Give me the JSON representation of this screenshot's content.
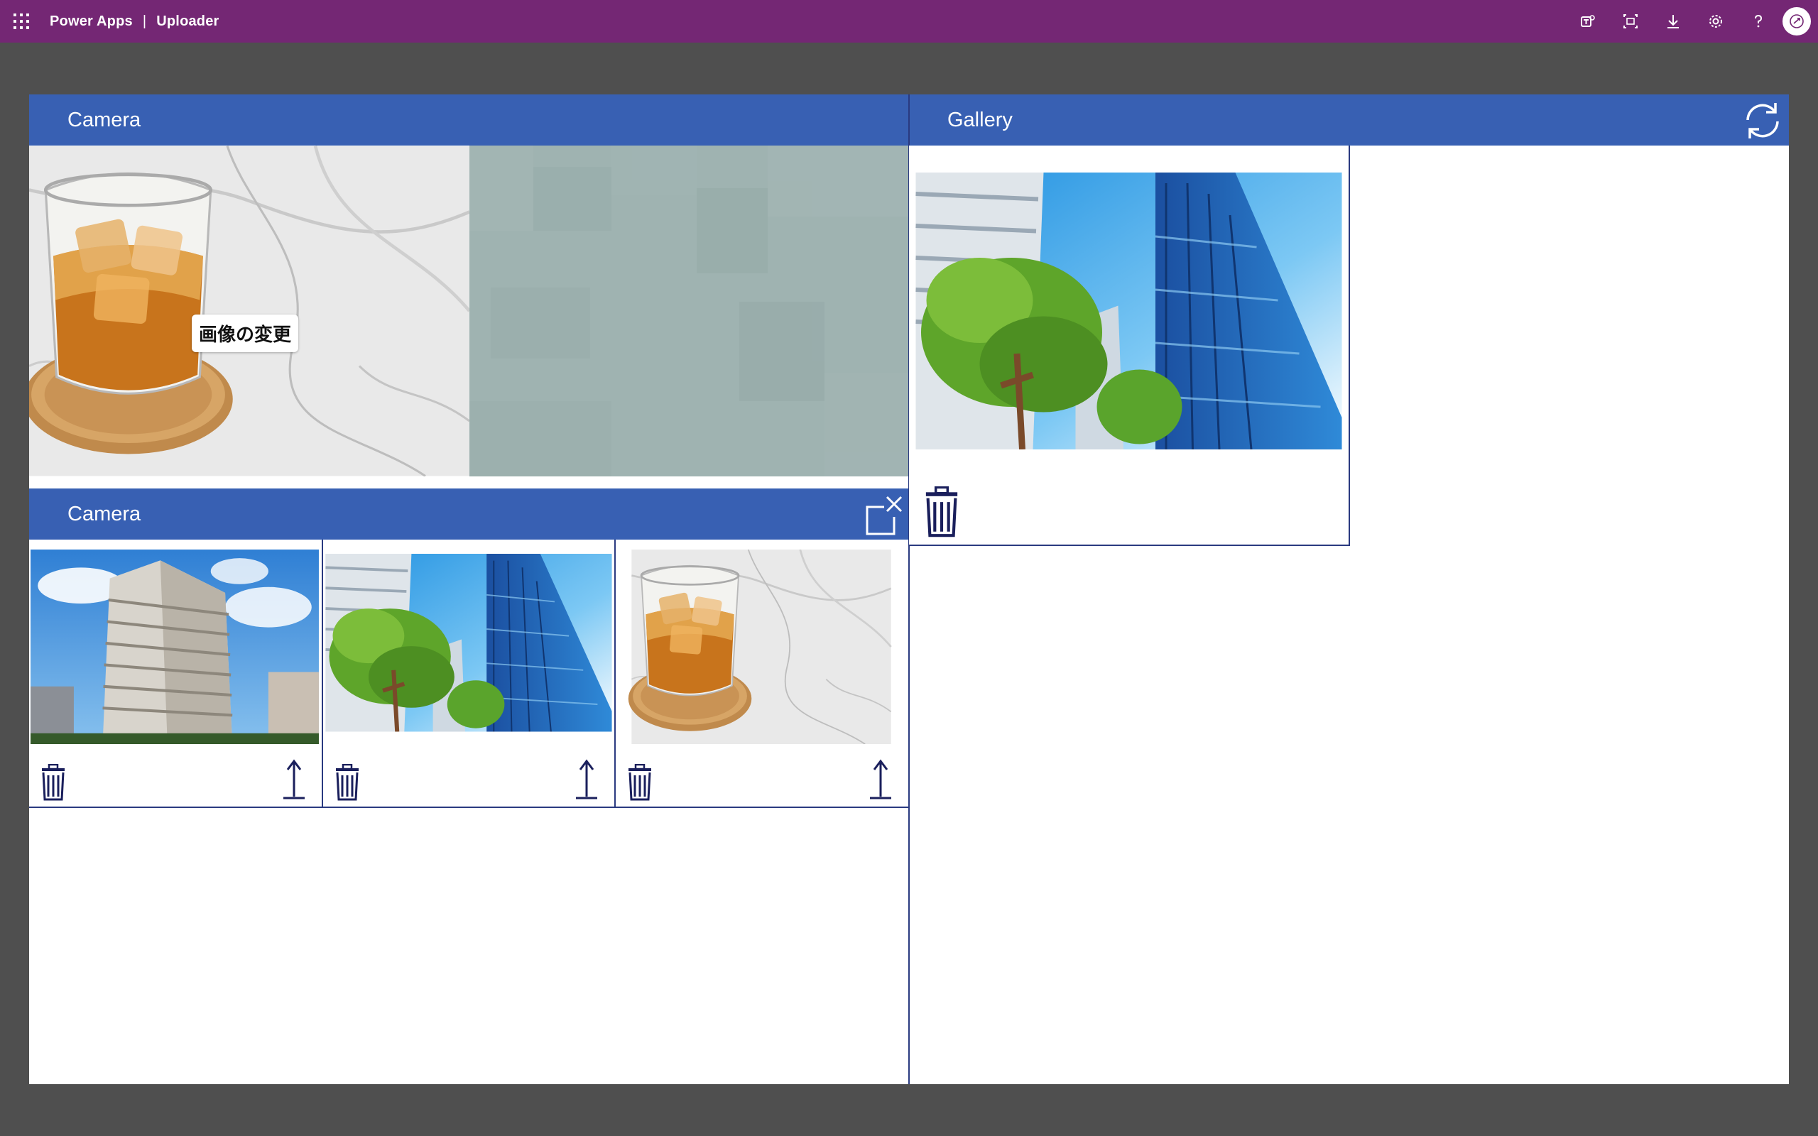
{
  "topbar": {
    "product": "Power Apps",
    "separator": "|",
    "app_name": "Uploader",
    "bg_color": "#742774",
    "icons": [
      "waffle-icon",
      "teams-icon",
      "fit-screen-icon",
      "download-icon",
      "settings-icon",
      "help-icon",
      "avatar"
    ]
  },
  "camera_panel": {
    "title": "Camera",
    "change_image_label": "画像の変更"
  },
  "camera_list_panel": {
    "title": "Camera",
    "items": [
      {
        "image": "apartment-building-photo"
      },
      {
        "image": "glass-tower-with-trees-photo"
      },
      {
        "image": "whisky-glass-on-marble-photo"
      }
    ]
  },
  "gallery_panel": {
    "title": "Gallery",
    "items": [
      {
        "image": "glass-tower-with-trees-photo"
      }
    ]
  },
  "colors": {
    "header_blue": "#3860b3",
    "border_navy": "#2a3a80",
    "icon_navy": "#1a1f5c",
    "page_bg": "#4f4f4f"
  }
}
